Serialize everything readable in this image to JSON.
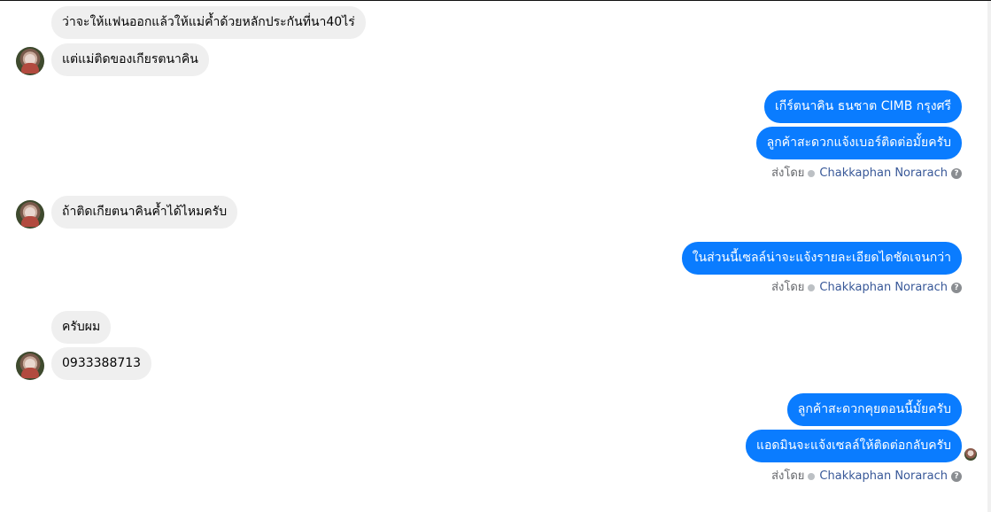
{
  "messages": {
    "incoming_1": "ว่าจะให้แฟนออกแล้วให้แม่ค้ำด้วยหลักประกันที่นา40ไร่",
    "incoming_2": "แต่แม่ติดของเกียรตนาคิน",
    "outgoing_1": "เกีร์ตนาคิน ธนชาต CIMB กรุงศรี",
    "outgoing_2": "ลูกค้าสะดวกแจ้งเบอร์ติดต่อมั้ยครับ",
    "incoming_3": "ถ้าติดเกียตนาคินค้ำได้ไหมครับ",
    "outgoing_3": "ในส่วนนี้เซลล์น่าจะแจ้งรายละเอียดไดชัดเจนกว่า",
    "incoming_4": "ครับผม",
    "incoming_5": "0933388713",
    "outgoing_4": "ลูกค้าสะดวกคุยตอนนี้มั้ยครับ",
    "outgoing_5": "แอดมินจะแจ้งเซลล์ให้ติดต่อกลับครับ"
  },
  "sent_by": {
    "prefix": "ส่งโดย",
    "sender": "Chakkaphan Norarach",
    "help": "?"
  },
  "colors": {
    "outgoing_bubble": "#0a7cff",
    "incoming_bubble": "#efefef",
    "sender_link": "#385898"
  }
}
